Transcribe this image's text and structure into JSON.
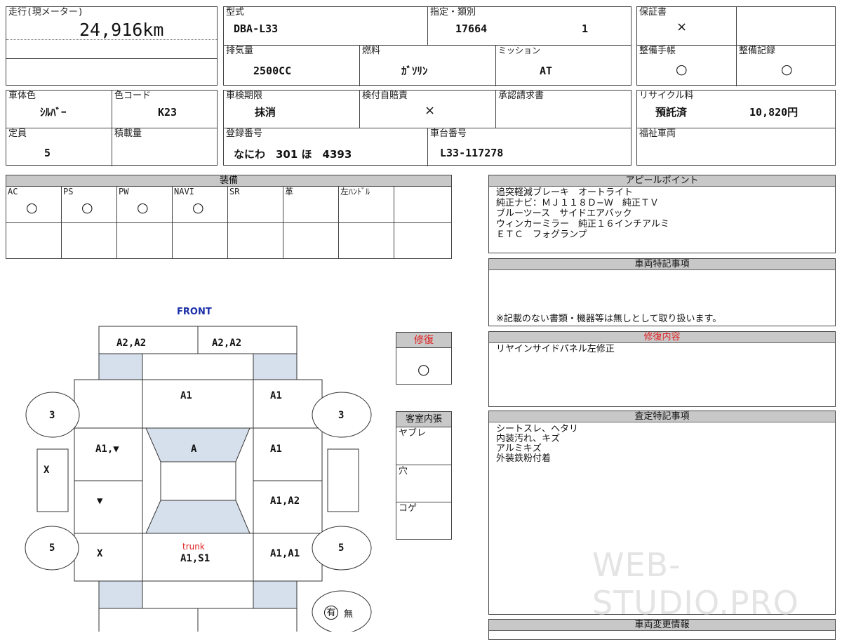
{
  "mileage": {
    "label": "走行(現メーター)",
    "value": "24,916km"
  },
  "spec": {
    "model_label": "型式",
    "model": "DBA-L33",
    "designation_label": "指定・類別",
    "designation": "17664",
    "category": "1",
    "displacement_label": "排気量",
    "displacement": "2500CC",
    "fuel_label": "燃料",
    "fuel": "ｶﾞｿﾘﾝ",
    "transmission_label": "ミッション",
    "transmission": "AT"
  },
  "warranty": {
    "label": "保証書",
    "value": "×",
    "maint_book_label": "整備手帳",
    "maint_book": "○",
    "maint_record_label": "整備記録",
    "maint_record": "○"
  },
  "body": {
    "color_label": "車体色",
    "color": "ｼﾙﾊﾞｰ",
    "color_code_label": "色コード",
    "color_code": "K23",
    "capacity_label": "定員",
    "capacity": "5",
    "load_label": "積載量",
    "load": ""
  },
  "inspection": {
    "expiry_label": "車検期限",
    "expiry": "抹消",
    "liability_label": "検付自賠責",
    "liability": "×",
    "approval_label": "承認請求書",
    "approval": "",
    "reg_label": "登録番号",
    "reg": "なにわ　301 ほ　4393",
    "chassis_label": "車台番号",
    "chassis": "L33-117278"
  },
  "recycle": {
    "label": "リサイクル料",
    "status": "預託済",
    "amount": "10,820円"
  },
  "welfare": {
    "label": "福祉車両",
    "value": ""
  },
  "equipment": {
    "title": "装備",
    "items": [
      {
        "label": "AC",
        "value": "○"
      },
      {
        "label": "PS",
        "value": "○"
      },
      {
        "label": "PW",
        "value": "○"
      },
      {
        "label": "NAVI",
        "value": "○"
      },
      {
        "label": "SR",
        "value": ""
      },
      {
        "label": "革",
        "value": ""
      },
      {
        "label": "左ﾊﾝﾄﾞﾙ",
        "value": ""
      },
      {
        "label": "",
        "value": ""
      }
    ]
  },
  "appeal": {
    "title": "アピールポイント",
    "lines": [
      "追突軽減ブレーキ　オートライト",
      "純正ナビ：ＭＪ１１８Ｄ−Ｗ　純正ＴＶ",
      "ブルーツース　サイドエアバック",
      "ウィンカーミラー　純正１６インチアルミ",
      "ＥＴＣ　フォグランプ"
    ]
  },
  "vehicle_notes": {
    "title": "車両特記事項",
    "note": "※記載のない書類・機器等は無しとして取り扱います。"
  },
  "repair_content": {
    "title": "修復内容",
    "text": "リヤインサイドパネル左修正"
  },
  "assessment": {
    "title": "査定特記事項",
    "lines": [
      "シートスレ、ヘタリ",
      "内装汚れ、キズ",
      "アルミキズ",
      "外装鉄粉付着"
    ]
  },
  "change_info": {
    "title": "車両変更情報"
  },
  "repair": {
    "label": "修復",
    "value": "○"
  },
  "interior": {
    "title": "客室内張",
    "items": [
      "ヤブレ",
      "穴",
      "コゲ"
    ]
  },
  "diagram": {
    "front": "FRONT",
    "front_left": "A2,A2",
    "front_right": "A2,A2",
    "hood_left": "",
    "hood_center": "A1",
    "hood_right": "A1",
    "left_mid": "A1,▼",
    "roof": "A",
    "right_mid": "A1",
    "left_rear": "▼",
    "right_rear": "A1,A2",
    "rear_left": "X",
    "trunk_label": "trunk",
    "trunk": "A1,S1",
    "rear_right": "A1,A1",
    "tire_fl": "3",
    "tire_fr": "3",
    "tire_rl": "5",
    "tire_rr": "5",
    "left_step": "X",
    "right_step": "",
    "spare_yes": "有",
    "spare_no": "無"
  },
  "watermark": "WEB-STUDIO.PRO",
  "colors": {
    "blue_panel": "#d6e0ec",
    "header_gray": "#c8c8c8",
    "red": "#e02020",
    "front_blue": "#1a2fa8"
  }
}
